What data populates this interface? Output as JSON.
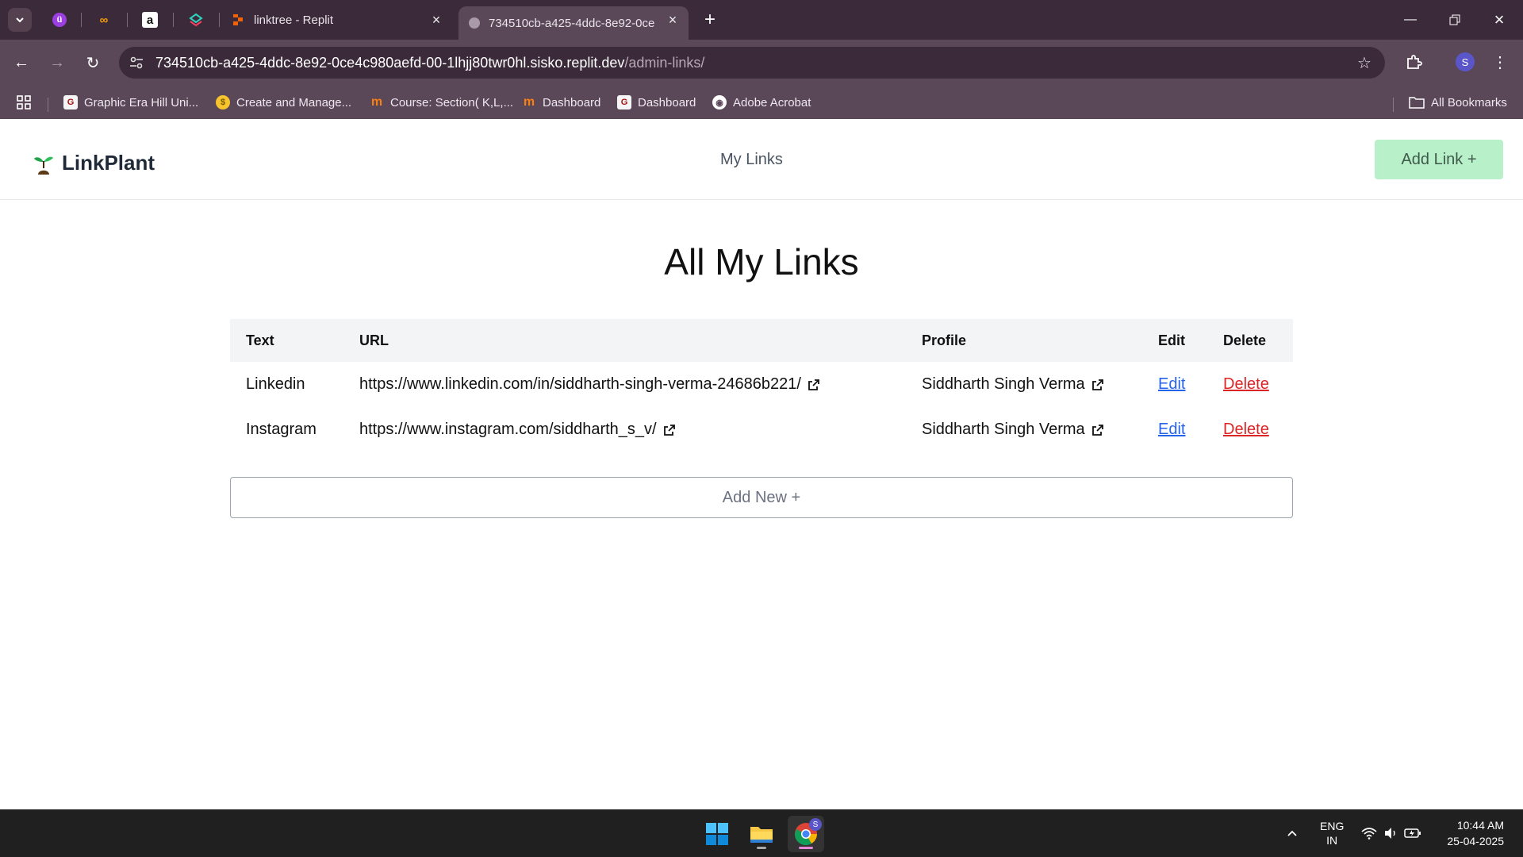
{
  "browser": {
    "tabs": [
      {
        "title": "linktree - Replit",
        "active": false
      },
      {
        "title": "734510cb-a425-4ddc-8e92-0ce",
        "active": true
      }
    ],
    "address": {
      "host": "734510cb-a425-4ddc-8e92-0ce4c980aefd-00-1lhjj80twr0hl.sisko.replit.dev",
      "path": "/admin-links/"
    },
    "profile_initial": "S",
    "bookmarks": [
      {
        "label": "Graphic Era Hill Uni...",
        "icon": "ge-icon"
      },
      {
        "label": "Create and Manage...",
        "icon": "coin-icon"
      },
      {
        "label": "Course: Section( K,L,...",
        "icon": "moodle-icon"
      },
      {
        "label": "Dashboard",
        "icon": "moodle-icon"
      },
      {
        "label": "Dashboard",
        "icon": "ge-icon"
      },
      {
        "label": "Adobe Acrobat",
        "icon": "globe-icon"
      }
    ],
    "all_bookmarks_label": "All Bookmarks"
  },
  "site": {
    "logo_text": "LinkPlant",
    "nav_link": "My Links",
    "add_link_label": "Add Link +",
    "page_title": "All My Links",
    "table": {
      "headers": [
        "Text",
        "URL",
        "Profile",
        "Edit",
        "Delete"
      ],
      "rows": [
        {
          "text": "Linkedin",
          "url": "https://www.linkedin.com/in/siddharth-singh-verma-24686b221/",
          "profile": "Siddharth Singh Verma",
          "edit": "Edit",
          "delete": "Delete"
        },
        {
          "text": "Instagram",
          "url": "https://www.instagram.com/siddharth_s_v/",
          "profile": "Siddharth Singh Verma",
          "edit": "Edit",
          "delete": "Delete"
        }
      ]
    },
    "add_new_label": "Add New +"
  },
  "taskbar": {
    "language": "ENG",
    "region": "IN",
    "time": "10:44 AM",
    "date": "25-04-2025",
    "chrome_badge": "S"
  },
  "colors": {
    "accent_green": "#b7f0c9",
    "edit_blue": "#2563eb",
    "delete_red": "#dc2626",
    "chrome_frame": "#5a4758"
  }
}
